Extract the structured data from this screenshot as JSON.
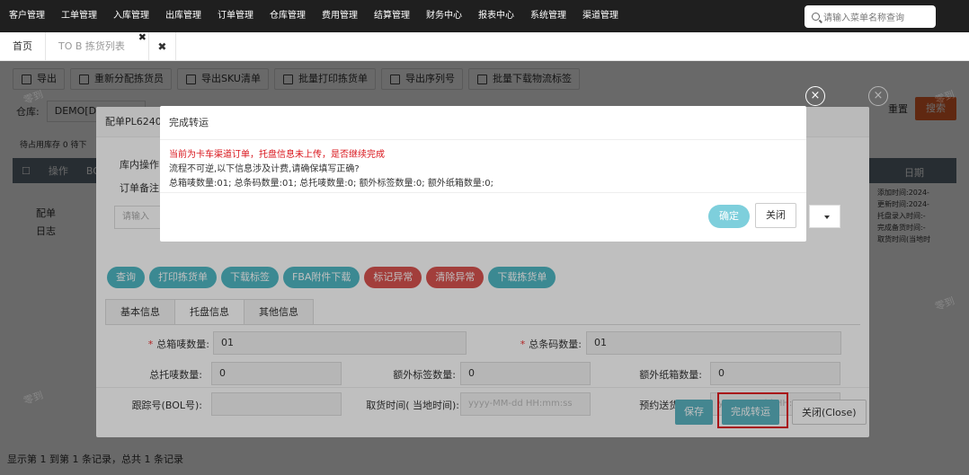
{
  "nav": {
    "items": [
      "客户管理",
      "工单管理",
      "入库管理",
      "出库管理",
      "订单管理",
      "仓库管理",
      "费用管理",
      "结算管理",
      "财务中心",
      "报表中心",
      "系统管理",
      "渠道管理"
    ],
    "search_placeholder": "请输入菜单名称查询"
  },
  "tabs": {
    "home": "首页",
    "active": "TO B 拣货列表",
    "close_glyph": "✖"
  },
  "toolbar": {
    "buttons": [
      "导出",
      "重新分配拣货员",
      "导出SKU清单",
      "批量打印拣货单",
      "导出序列号",
      "批量下载物流标签"
    ]
  },
  "filter": {
    "warehouse_label": "仓库:",
    "warehouse_value": "DEMO[D",
    "reset": "重置",
    "search": "搜索"
  },
  "grid": {
    "stock_info": "待占用库存 0    待下",
    "col_op": "操作",
    "col_bol": "BOL",
    "col_date": "日期",
    "row_ops": [
      "配单",
      "日志"
    ],
    "row_date_lines": [
      "添加时间:2024-",
      "更新时间:2024-",
      "托盘录入时间:-",
      "完成备货时间:-",
      "取货时间(当地时"
    ]
  },
  "footer": {
    "text": "显示第 1 到第 1 条记录，总共 1 条记录"
  },
  "inner_modal": {
    "title": "配单PL6240",
    "field_inwarehouse": "库内操作",
    "field_remark": "订单备注",
    "input_placeholder": "请输入",
    "buttons_teal": [
      "查询",
      "打印拣货单",
      "下载标签",
      "FBA附件下载"
    ],
    "buttons_red": [
      "标记异常",
      "清除异常"
    ],
    "button_download": "下载拣货单",
    "subtabs": [
      "基本信息",
      "托盘信息",
      "其他信息"
    ],
    "form": {
      "total_boxes_label": "总箱唛数量:",
      "total_boxes_value": "01",
      "total_barcodes_label": "总条码数量:",
      "total_barcodes_value": "01",
      "total_pallets_label": "总托唛数量:",
      "total_pallets_value": "0",
      "extra_labels_label": "额外标签数量:",
      "extra_labels_value": "0",
      "extra_paper_label": "额外纸箱数量:",
      "extra_paper_value": "0",
      "tracking_label": "跟踪号(BOL号):",
      "pickup_time_label": "取货时间( 当地时间):",
      "pickup_time_placeholder": "yyyy-MM-dd HH:mm:ss",
      "delivery_time_label": "预约送货时间:",
      "delivery_time_placeholder": "yyyy-MM-dd HH:mm:ss"
    },
    "footer": {
      "save": "保存",
      "finish": "完成转运",
      "close": "关闭(Close)"
    }
  },
  "dialog": {
    "title": "完成转运",
    "warning": "当前为卡车渠道订单，托盘信息未上传，是否继续完成",
    "line2": "流程不可逆,以下信息涉及计费,请确保填写正确?",
    "line3": "总箱唛数量:01; 总条码数量:01; 总托唛数量:0; 额外标签数量:0; 额外纸箱数量:0;",
    "ok": "确定",
    "cancel": "关闭"
  },
  "watermark_text": "零到",
  "colors": {
    "nav_bg": "#1f1f1f",
    "teal": "#5bb3c0",
    "red": "#d9534f",
    "orange": "#e9632a",
    "highlight": "#e0151c",
    "warning_text": "#d9141b"
  }
}
